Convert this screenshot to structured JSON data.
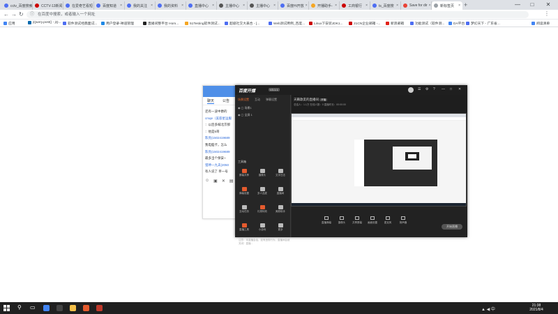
{
  "browser": {
    "tabs": [
      {
        "label": "cctv_百度搜索",
        "fav": "#4e6ef2"
      },
      {
        "label": "CCTV-13新闻",
        "fav": "#c00"
      },
      {
        "label": "在爱奇艺看短",
        "fav": "#4e6ef2"
      },
      {
        "label": "百度知道",
        "fav": "#4e6ef2"
      },
      {
        "label": "我的关注",
        "fav": "#4e6ef2"
      },
      {
        "label": "我的资料",
        "fav": "#4e6ef2"
      },
      {
        "label": "直播中心",
        "fav": "#4e6ef2"
      },
      {
        "label": "主播中心",
        "fav": "#555"
      },
      {
        "label": "主播中心",
        "fav": "#555"
      },
      {
        "label": "百度Hi开放",
        "fav": "#4e6ef2"
      },
      {
        "label": "开播助手-",
        "fav": "#f5a623"
      },
      {
        "label": "工商银行",
        "fav": "#c00"
      },
      {
        "label": "ts_百度搜",
        "fav": "#4e6ef2"
      },
      {
        "label": "Save for dir",
        "fav": "#e94235"
      },
      {
        "label": "新标签页",
        "fav": "#9aa0a6"
      }
    ],
    "new_tab": "+",
    "window": {
      "minimize": "—",
      "maximize": "□",
      "close": "✕"
    },
    "nav": {
      "back": "←",
      "forward": "→",
      "reload": "↻"
    },
    "omnibox_placeholder": "在百度中搜索，或者输入一个网址",
    "menu": "⋮",
    "bookmarks": [
      {
        "label": "应用",
        "color": "#4285f4"
      },
      {
        "label": "jQuery.post() - jQ...",
        "color": "#0769ad"
      },
      {
        "label": "软件测试经典面试...",
        "color": "#4e6ef2"
      },
      {
        "label": "用户登录-禅道管理",
        "color": "#1e88e5"
      },
      {
        "label": "直播间整平台 Hom...",
        "color": "#222"
      },
      {
        "label": "51Testing软件测试...",
        "color": "#f5a623"
      },
      {
        "label": "超级社交大表合 - [...",
        "color": "#4e6ef2"
      },
      {
        "label": "Web测试用例_百度...",
        "color": "#4e6ef2"
      },
      {
        "label": "Linux下安装JDK1...",
        "color": "#c00"
      },
      {
        "label": "21CN企业邮箱 -...",
        "color": "#c00"
      },
      {
        "label": "新浪邮箱",
        "color": "#e2231a"
      },
      {
        "label": "功能测试（软件测...",
        "color": "#4e6ef2"
      },
      {
        "label": "DA平台",
        "color": "#4285f4"
      },
      {
        "label": "梦幻天下 - 广东省...",
        "color": "#4e6ef2"
      },
      {
        "label": "阅读清单",
        "color": "#4285f4"
      }
    ]
  },
  "chat": {
    "tabs": [
      "聊天",
      "公告"
    ],
    "messages": [
      {
        "text": "还有一波中爵的",
        "blue": false
      },
      {
        "text": "cmqe（美容星运服",
        "blue": true
      },
      {
        "text": "：以后多喊北京那",
        "blue": false
      },
      {
        "text": "：他是5哥",
        "blue": false
      },
      {
        "text": "陈亮(1502419689",
        "blue": true
      },
      {
        "text": "我电脑卡，怎么",
        "blue": false
      },
      {
        "text": "陈亮(1502419689",
        "blue": true
      },
      {
        "text": "最多当个保安~",
        "blue": false
      },
      {
        "text": "猎神一九夫(2050",
        "blue": true
      },
      {
        "text": "有人说了 单一号",
        "blue": false
      }
    ]
  },
  "live": {
    "logo": "百度开播",
    "version": "V3.1.1",
    "side_tabs": [
      "场景设置",
      "互动",
      "弹幕设置"
    ],
    "scenes": [
      "场景1",
      "全屏 1"
    ],
    "section_title": "工具箱",
    "tools": [
      {
        "label": "屏幕共享",
        "hot": true
      },
      {
        "label": "摄像头",
        "hot": false
      },
      {
        "label": "文字日志",
        "hot": false
      },
      {
        "label": "弹幕设置",
        "hot": true
      },
      {
        "label": "多人连麦",
        "hot": false
      },
      {
        "label": "直播间",
        "hot": false
      },
      {
        "label": "互动任务",
        "hot": false
      },
      {
        "label": "礼物特效",
        "hot": true
      },
      {
        "label": "美颜助手",
        "hot": false
      },
      {
        "label": "直播工具",
        "hot": true
      },
      {
        "label": "小游戏",
        "hot": false
      },
      {
        "label": "更多",
        "hot": false
      }
    ],
    "notice": "注意：本直播会话，如有违规行为，直播间会被关闭！直播...",
    "room_name": "天籁歌友的直播间",
    "room_tag": "开播",
    "meta": "总结人：1.1万  在线人数：0  直播时长：00:00:00",
    "controls": [
      "直播弹幕",
      "摄像头",
      "共享屏幕",
      "画面设置",
      "麦克风",
      "扬声器"
    ],
    "start_button": "开始直播"
  },
  "taskbar": {
    "time": "21:38",
    "date": "2021/8/4",
    "apps": [
      {
        "name": "chrome",
        "color": "#4285f4"
      },
      {
        "name": "obs",
        "color": "#444"
      },
      {
        "name": "folder",
        "color": "#f5c04a"
      },
      {
        "name": "live",
        "color": "#e55b2e"
      },
      {
        "name": "app",
        "color": "#c0392b"
      }
    ]
  }
}
